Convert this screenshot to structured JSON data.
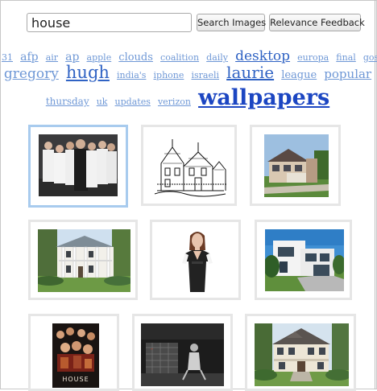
{
  "search": {
    "value": "house"
  },
  "buttons": {
    "search_images": "Search Images",
    "relevance_feedback": "Relevance Feedback"
  },
  "tag_cloud": {
    "line1": [
      "31",
      "afp",
      "air",
      "ap",
      "apple",
      "clouds",
      "coalition",
      "daily",
      "desktop",
      "europa",
      "final",
      "gossip"
    ],
    "line2": [
      "gregory",
      "hugh",
      "india's",
      "iphone",
      "israeli",
      "laurie",
      "league",
      "popular"
    ],
    "line3": [
      "thursday",
      "uk",
      "updates",
      "verizon",
      "wallpapers"
    ]
  },
  "results": [
    {
      "name": "cast-photo",
      "selected": true
    },
    {
      "name": "victorian-house-sketch",
      "selected": false
    },
    {
      "name": "modern-house-photo",
      "selected": false
    },
    {
      "name": "colonial-mansion-photo",
      "selected": false
    },
    {
      "name": "woman-portrait",
      "selected": false
    },
    {
      "name": "white-modern-house",
      "selected": false
    },
    {
      "name": "house-poster",
      "selected": false,
      "caption": "HOUSE"
    },
    {
      "name": "bw-photo",
      "selected": false
    },
    {
      "name": "suburban-house-photo",
      "selected": false
    }
  ]
}
